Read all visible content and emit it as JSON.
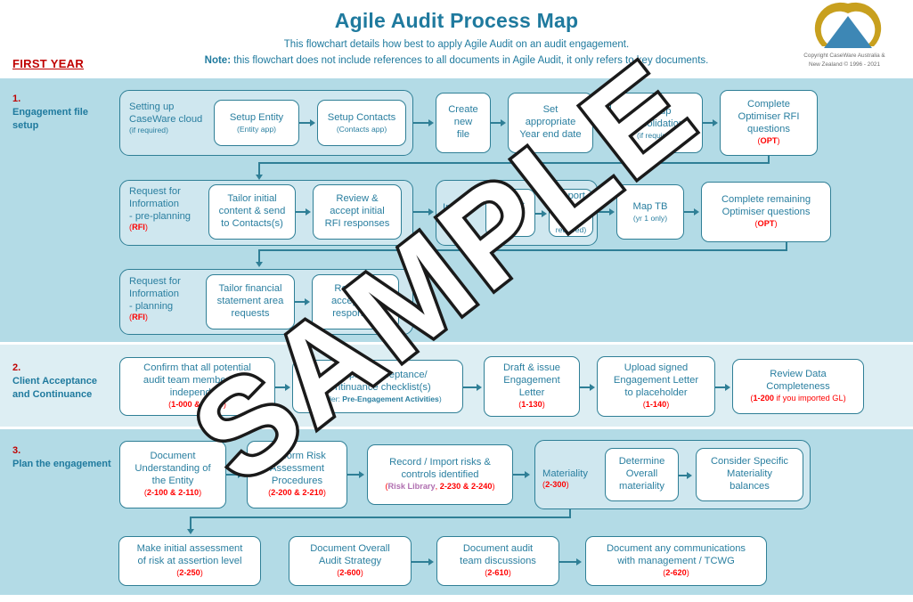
{
  "header": {
    "title": "Agile Audit Process Map",
    "subtitle_line1": "This flowchart details how best to apply Agile Audit on an audit engagement.",
    "subtitle_note_label": "Note:",
    "subtitle_line2": " this flowchart does not include references to all documents in Agile Audit, it only refers to key documents.",
    "first_year_label": "FIRST YEAR",
    "copyright_line1": "Copyright CaseWare Australia &",
    "copyright_line2": "New Zealand © 1996 - 2021",
    "logo_name": "caseware-logo"
  },
  "watermark": {
    "text": "SAMPLE"
  },
  "colors": {
    "accent_blue": "#2a7fa0",
    "border_blue": "#2f7f96",
    "band_dark": "#b3dbe6",
    "band_light": "#ddeef3",
    "group_fill": "#cfe7ef",
    "code_red": "#ff0000",
    "section_number_red": "#c00000",
    "risk_library_purple": "#b06fb0",
    "logo_gold": "#c8a01e",
    "logo_blue": "#3d87b5"
  },
  "sections": [
    {
      "number": "1.",
      "name": "Engagement file setup"
    },
    {
      "number": "2.",
      "name": "Client Acceptance and Continuance"
    },
    {
      "number": "3.",
      "name": "Plan the engagement"
    }
  ],
  "groups": {
    "cloud_setup": {
      "label_line1": "Setting up",
      "label_line2": "CaseWare cloud",
      "label_sub": "(if required)"
    },
    "rfi_preplanning": {
      "label_line1": "Request for",
      "label_line2": "Information",
      "label_line3": "- pre-planning",
      "code": "RFI"
    },
    "rfi_planning": {
      "label_line1": "Request for",
      "label_line2": "Information",
      "label_line3": "- planning",
      "code": "RFI"
    },
    "import_data": {
      "label_line1": "Import",
      "label_line2": "data"
    },
    "materiality": {
      "label_line1": "Materiality",
      "code": "2-300"
    }
  },
  "boxes": {
    "setup_entity": {
      "title": "Setup Entity",
      "sub": "(Entity app)"
    },
    "setup_contacts": {
      "title": "Setup Contacts",
      "sub": "(Contacts app)"
    },
    "create_new_file": {
      "title": "Create\nnew\nfile"
    },
    "set_year_end": {
      "title": "Set\nappropriate\nYear end date"
    },
    "setup_consolidations": {
      "title": "Set-up\nConsolidations",
      "sub": "(if required)"
    },
    "complete_optimiser_rfi": {
      "title": "Complete\nOptimiser RFI\nquestions",
      "code": "OPT"
    },
    "tailor_initial_content": {
      "title": "Tailor initial\ncontent & send\nto Contacts(s)"
    },
    "review_accept_initial_rfi": {
      "title": "Review &\naccept initial\nRFI responses"
    },
    "import_tb": {
      "title": "Import\nTB"
    },
    "import_gl": {
      "title": "Import\nGL",
      "sub": "(if required)"
    },
    "map_tb": {
      "title": "Map TB",
      "sub": "(yr 1 only)"
    },
    "complete_remaining_optimiser": {
      "title": "Complete remaining\nOptimiser questions",
      "code": "OPT"
    },
    "tailor_fs_area_requests": {
      "title": "Tailor financial\nstatement area\nrequests"
    },
    "review_accept_rfi_responses": {
      "title": "Review &\naccept RFI\nresponses"
    },
    "confirm_independence": {
      "title": "Confirm that all potential\naudit team members are\nindependent",
      "code": "1-000 & 1-005"
    },
    "acceptance_checklist": {
      "title": "Complete acceptance/\ncontinuance checklist(s)",
      "sub_prefix": "(Folder: ",
      "sub_bold": "Pre-Engagement Activities",
      "sub_suffix": ")"
    },
    "engagement_letter": {
      "title": "Draft & issue\nEngagement\nLetter",
      "code": "1-130"
    },
    "upload_signed_letter": {
      "title": "Upload signed\nEngagement Letter\nto placeholder",
      "code": "1-140"
    },
    "review_data_completeness": {
      "title": "Review Data\nCompleteness",
      "code_bold": "1-200",
      "code_tail": " if you imported GL"
    },
    "document_understanding": {
      "title": "Document\nUnderstanding of\nthe Entity",
      "code": "2-100 & 2-110"
    },
    "perform_risk_assessment": {
      "title": "Perform Risk\nAssessment\nProcedures",
      "code": "2-200 & 2-210"
    },
    "record_import_risks": {
      "title": "Record / Import risks &\ncontrols identified",
      "code_lib": "Risk Library",
      "code_tail": "2-230 & 2-240"
    },
    "determine_overall_materiality": {
      "title": "Determine\nOverall\nmateriality"
    },
    "consider_specific_materiality": {
      "title": "Consider Specific\nMateriality\nbalances"
    },
    "make_initial_assessment": {
      "title": "Make initial assessment\nof risk at assertion level",
      "code": "2-250"
    },
    "document_audit_strategy": {
      "title": "Document Overall\nAudit Strategy",
      "code": "2-600"
    },
    "document_team_discussions": {
      "title": "Document audit\nteam discussions",
      "code": "2-610"
    },
    "document_communications": {
      "title": "Document any communications\nwith management / TCWG",
      "code": "2-620"
    }
  }
}
